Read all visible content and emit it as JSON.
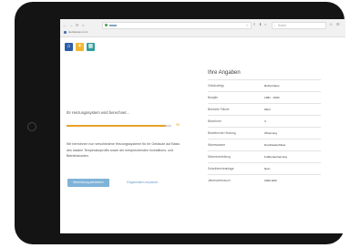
{
  "browser": {
    "nav_icons": [
      "←",
      "→",
      "⟳",
      "⌂"
    ],
    "search_placeholder": "Suche",
    "toolbar_icons": [
      "≡",
      "⬇",
      "⌂",
      "☺",
      "☰"
    ],
    "bookmark_label": "Heizkosten.com"
  },
  "app_icons": [
    {
      "name": "home-icon",
      "glyph": "⌂",
      "color": "#2d5fa8"
    },
    {
      "name": "sun-icon",
      "glyph": "☀",
      "color": "#f0b632"
    },
    {
      "name": "heater-icon",
      "glyph": "▦",
      "color": "#2f9d9b"
    }
  ],
  "calc": {
    "title": "Ihr Heizungssystem wird berechnet...",
    "progress_percent": 0.95,
    "progress_label": "95",
    "description": "Wir berechnen nun verschiedene Heizungssysteme für Ihr Gebäude auf Basis des lokalen Temperaturprofils sowie der entsprechenden Investitions- und Betriebskosten.",
    "primary_button": "Berechnung abbrechen",
    "secondary_link": "Eingabedaten anpassen"
  },
  "inputs": {
    "title": "Ihre Angaben",
    "rows": [
      {
        "label": "Gebäudetyp",
        "value": "Reihenhaus"
      },
      {
        "label": "Baujahr",
        "value": "1981 - 2000"
      },
      {
        "label": "Beheizte Fläche",
        "value": "90m²"
      },
      {
        "label": "Bewohner",
        "value": "3"
      },
      {
        "label": "Bestehende Heizung",
        "value": "Ölheizung"
      },
      {
        "label": "Warmwasser",
        "value": "Durchlauferhitzer"
      },
      {
        "label": "Wärmeverteilung",
        "value": "Fußbodenheizung"
      },
      {
        "label": "Solarthermieanlage",
        "value": "Nein"
      },
      {
        "label": "Jahresverbrauch",
        "value": "2000 kWh"
      }
    ]
  }
}
